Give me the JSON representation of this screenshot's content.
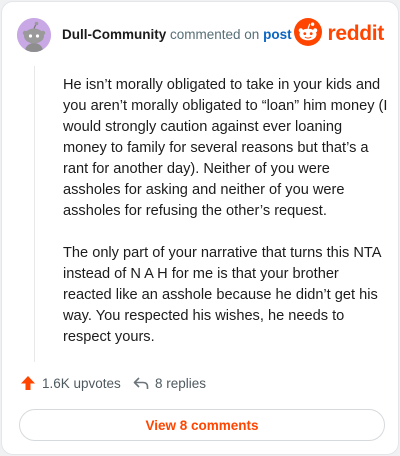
{
  "comment": {
    "username": "Dull-Community",
    "commented_on_text": "commented on",
    "post_link": "post",
    "paragraphs": [
      "He isn’t morally obligated to take in your kids and you aren’t morally obligated to “loan” him money (I would strongly caution against ever loaning money to family for several reasons but that’s a rant for another day). Neither of you were assholes for asking and neither of you were assholes for refusing the other’s request.",
      "The only part of your narrative that turns this NTA instead of N A H for me is that your brother reacted like an asshole because he didn’t get his way. You respected his wishes, he needs to respect yours."
    ]
  },
  "brand": {
    "name": "reddit",
    "color": "#ff4500"
  },
  "actions": {
    "upvotes": "1.6K upvotes",
    "replies": "8 replies"
  },
  "view_comments_label": "View 8 comments",
  "icons": {
    "avatar": "snoo-avatar-icon",
    "logo": "reddit-logo-icon",
    "upvote": "upvote-arrow-icon",
    "reply": "reply-arrow-icon"
  }
}
